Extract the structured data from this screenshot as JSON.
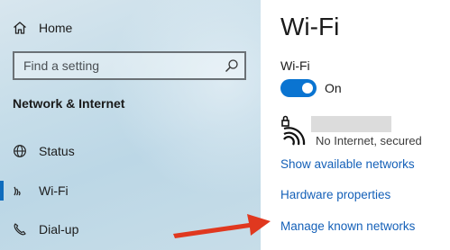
{
  "nav": {
    "home_label": "Home",
    "search_placeholder": "Find a setting",
    "section_title": "Network & Internet",
    "items": [
      {
        "label": "Status",
        "icon": "globe-icon"
      },
      {
        "label": "Wi-Fi",
        "icon": "wifi-icon",
        "active": true
      },
      {
        "label": "Dial-up",
        "icon": "phone-icon"
      }
    ]
  },
  "content": {
    "title": "Wi-Fi",
    "wifi_label": "Wi-Fi",
    "toggle_state": "On",
    "toggle_on": true,
    "network_status": "No Internet, secured",
    "links": {
      "show_networks": "Show available networks",
      "hardware_properties": "Hardware properties",
      "manage_known": "Manage known networks"
    }
  },
  "colors": {
    "accent": "#0a74d1",
    "link": "#1460b8",
    "annotation_arrow": "#e0381f"
  }
}
